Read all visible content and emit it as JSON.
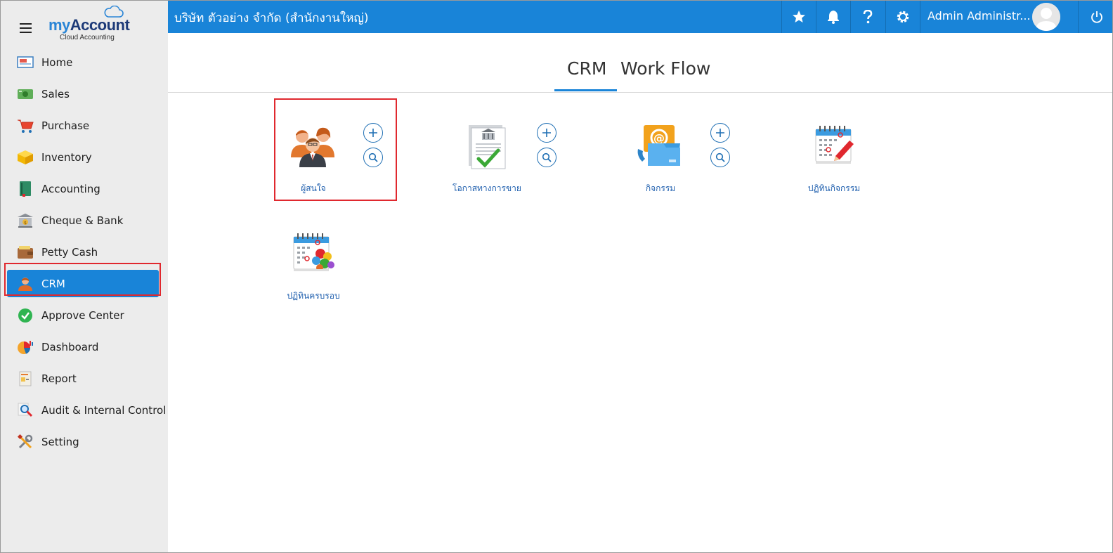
{
  "app": {
    "logo_my": "my",
    "logo_account": "Account",
    "logo_sub": "Cloud Accounting",
    "brand_color": "#1984d8"
  },
  "topbar": {
    "company": "บริษัท ตัวอย่าง จำกัด (สำนักงานใหญ่)",
    "user_name": "Admin Administr...",
    "icons": [
      "star-icon",
      "bell-icon",
      "help-icon",
      "gear-icon",
      "power-icon"
    ]
  },
  "sidebar": {
    "items": [
      {
        "label": "Home",
        "icon": "home-icon"
      },
      {
        "label": "Sales",
        "icon": "sales-icon"
      },
      {
        "label": "Purchase",
        "icon": "cart-icon"
      },
      {
        "label": "Inventory",
        "icon": "box-icon"
      },
      {
        "label": "Accounting",
        "icon": "ledger-icon"
      },
      {
        "label": "Cheque & Bank",
        "icon": "bank-icon"
      },
      {
        "label": "Petty Cash",
        "icon": "wallet-icon"
      },
      {
        "label": "CRM",
        "icon": "crm-icon",
        "active": true
      },
      {
        "label": "Approve Center",
        "icon": "check-icon"
      },
      {
        "label": "Dashboard",
        "icon": "pie-icon"
      },
      {
        "label": "Report",
        "icon": "report-icon"
      },
      {
        "label": "Audit & Internal Control",
        "icon": "audit-icon"
      },
      {
        "label": "Setting",
        "icon": "tools-icon"
      }
    ]
  },
  "tabs": [
    {
      "label": "CRM",
      "active": true
    },
    {
      "label": "Work Flow",
      "active": false
    }
  ],
  "tiles": [
    {
      "label": "ผู้สนใจ",
      "icon": "contacts-icon",
      "has_actions": true
    },
    {
      "label": "โอกาสทางการขาย",
      "icon": "sales-opportunity-icon",
      "has_actions": true
    },
    {
      "label": "กิจกรรม",
      "icon": "activity-email-icon",
      "has_actions": true
    },
    {
      "label": "ปฏิทินกิจกรรม",
      "icon": "activity-calendar-icon",
      "has_actions": false
    },
    {
      "label": "ปฏิทินครบรอบ",
      "icon": "anniversary-calendar-icon",
      "has_actions": false
    }
  ]
}
